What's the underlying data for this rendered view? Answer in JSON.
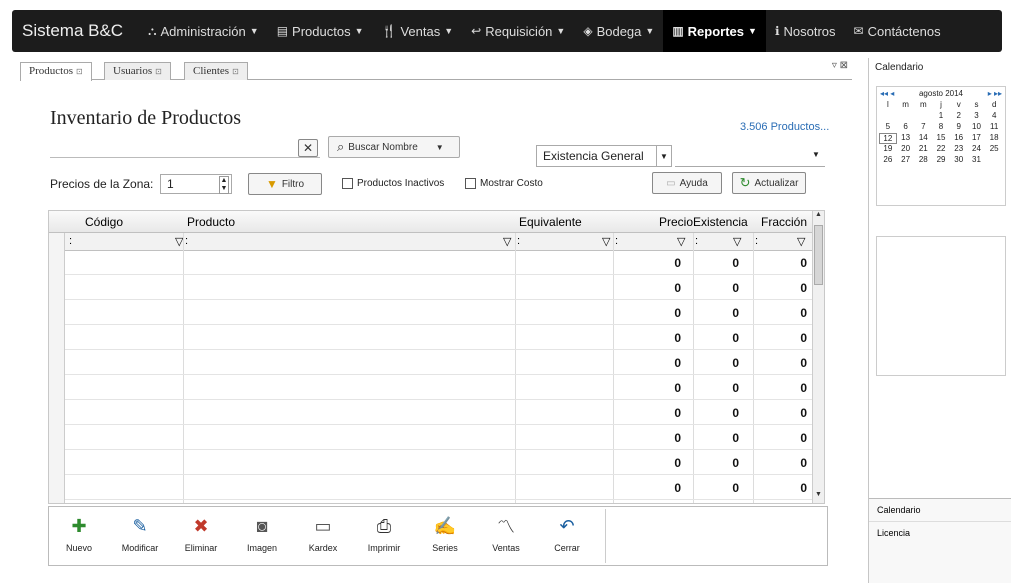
{
  "nav": {
    "brand": "Sistema B&C",
    "items": [
      {
        "label": "Administración",
        "icon": "sitemap-icon",
        "glyph": "⛬",
        "caret": true
      },
      {
        "label": "Productos",
        "icon": "list-icon",
        "glyph": "▤",
        "caret": true
      },
      {
        "label": "Ventas",
        "icon": "cutlery-icon",
        "glyph": "🍴",
        "caret": true
      },
      {
        "label": "Requisición",
        "icon": "reply-icon",
        "glyph": "↩",
        "caret": true
      },
      {
        "label": "Bodega",
        "icon": "tag-icon",
        "glyph": "◈",
        "caret": true
      },
      {
        "label": "Reportes",
        "icon": "bar-chart-icon",
        "glyph": "▥",
        "caret": true,
        "active": true
      },
      {
        "label": "Nosotros",
        "icon": "info-icon",
        "glyph": "ℹ",
        "caret": false
      },
      {
        "label": "Contáctenos",
        "icon": "envelope-icon",
        "glyph": "✉",
        "caret": false
      }
    ]
  },
  "tabs": [
    "Productos",
    "Usuarios",
    "Clientes"
  ],
  "panel_controls": "▿ ⊠",
  "page_title": "Inventario de Productos",
  "product_count": "3.506 Productos...",
  "search": {
    "clear_label": "✕",
    "button_label": "Buscar Nombre"
  },
  "stock_select": "Existencia General",
  "zone_label": "Precios de la Zona:",
  "zone_value": "1",
  "filter_label": "Filtro",
  "check_inactive": "Productos Inactivos",
  "check_cost": "Mostrar Costo",
  "help_label": "Ayuda",
  "refresh_label": "Actualizar",
  "grid": {
    "columns": [
      "Código",
      "Producto",
      "Equivalente",
      "Precio",
      "Existencia",
      "Fracción"
    ],
    "filter_marker": ":",
    "filter_icon": "▽",
    "rows": [
      [
        "0",
        "0",
        "0"
      ],
      [
        "0",
        "0",
        "0"
      ],
      [
        "0",
        "0",
        "0"
      ],
      [
        "0",
        "0",
        "0"
      ],
      [
        "0",
        "0",
        "0"
      ],
      [
        "0",
        "0",
        "0"
      ],
      [
        "0",
        "0",
        "0"
      ],
      [
        "0",
        "0",
        "0"
      ],
      [
        "0",
        "0",
        "0"
      ],
      [
        "0",
        "0",
        "0"
      ]
    ]
  },
  "toolbar": [
    {
      "label": "Nuevo",
      "icon": "new-icon",
      "glyph": "✚",
      "color": "#2e8b2e"
    },
    {
      "label": "Modificar",
      "icon": "pencil-icon",
      "glyph": "✎",
      "color": "#1a5fa0"
    },
    {
      "label": "Eliminar",
      "icon": "delete-icon",
      "glyph": "✖",
      "color": "#c0392b"
    },
    {
      "label": "Imagen",
      "icon": "camera-icon",
      "glyph": "◙",
      "color": "#555555"
    },
    {
      "label": "Kardex",
      "icon": "kardex-icon",
      "glyph": "▭",
      "color": "#555555"
    },
    {
      "label": "Imprimir",
      "icon": "printer-icon",
      "glyph": "⎙",
      "color": "#333333"
    },
    {
      "label": "Series",
      "icon": "series-icon",
      "glyph": "✍",
      "color": "#555555"
    },
    {
      "label": "Ventas",
      "icon": "chart-line-icon",
      "glyph": "〽",
      "color": "#333333"
    },
    {
      "label": "Cerrar",
      "icon": "close-icon",
      "glyph": "↶",
      "color": "#1a5fa0"
    }
  ],
  "sidebar": {
    "title": "Calendario",
    "month": "agosto 2014",
    "nav_prev": "◂◂ ◂",
    "nav_next": "▸ ▸▸",
    "weekdays": [
      "l",
      "m",
      "m",
      "j",
      "v",
      "s",
      "d"
    ],
    "weeks": [
      [
        "",
        "",
        "",
        "",
        "1",
        "2",
        "3",
        "4"
      ],
      [
        "5",
        "6",
        "7",
        "8",
        "9",
        "10",
        "11"
      ],
      [
        "12",
        "13",
        "14",
        "15",
        "16",
        "17",
        "18"
      ],
      [
        "19",
        "20",
        "21",
        "22",
        "23",
        "24",
        "25"
      ],
      [
        "26",
        "27",
        "28",
        "29",
        "30",
        "31",
        ""
      ]
    ],
    "footer_items": [
      "Calendario",
      "Licencia"
    ]
  }
}
